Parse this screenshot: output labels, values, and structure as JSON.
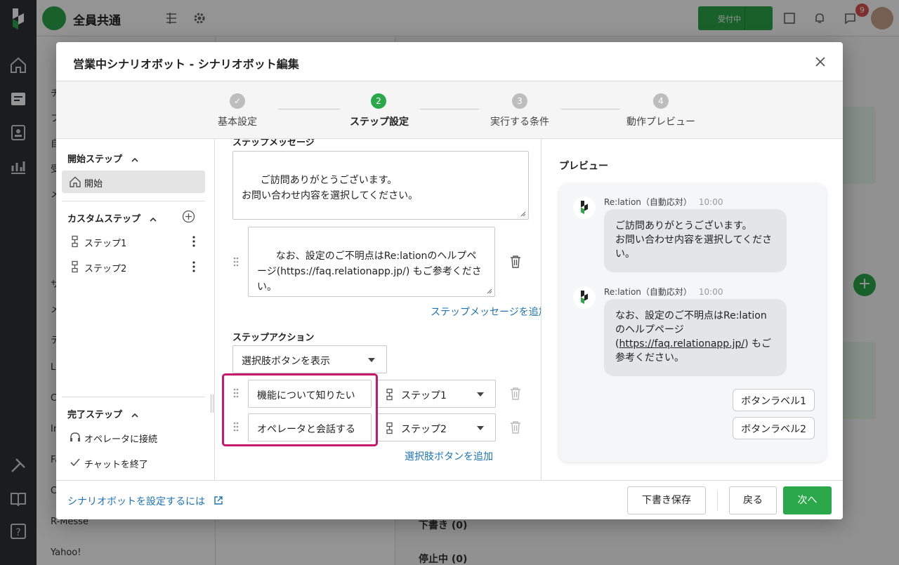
{
  "app": {
    "inbox_title": "全員共通",
    "status_label": "受付中",
    "notifications_count": "9",
    "sidebar_bg": [
      "チ",
      "フ",
      "自",
      "受",
      "メ",
      "サ",
      "メ",
      "テ",
      "L",
      "C",
      "In",
      "Fa",
      "C",
      "R-Messe",
      "Yahoo!"
    ],
    "main_sections": [
      "下書き (0)",
      "停止中 (0)"
    ]
  },
  "modal": {
    "title": "営業中シナリオボット - シナリオボット編集",
    "steps": [
      {
        "num": "✓",
        "label": "基本設定",
        "state": "done"
      },
      {
        "num": "2",
        "label": "ステップ設定",
        "state": "active"
      },
      {
        "num": "3",
        "label": "実行する条件",
        "state": "todo"
      },
      {
        "num": "4",
        "label": "動作プレビュー",
        "state": "todo"
      }
    ]
  },
  "left_panel": {
    "start_header": "開始ステップ",
    "start_item": "開始",
    "custom_header": "カスタムステップ",
    "custom_items": [
      "ステップ1",
      "ステップ2"
    ],
    "end_header": "完了ステップ",
    "end_items": [
      "オペレータに接続",
      "チャットを終了"
    ]
  },
  "center": {
    "message_label": "ステップメッセージ",
    "message1": "ご訪問ありがとうございます。\nお問い合わせ内容を選択してください。",
    "message2": "なお、設定のご不明点はRe:lationのヘルプページ(https://faq.relationapp.jp/) もご参考ください。",
    "add_message_link": "ステップメッセージを追加",
    "action_label": "ステップアクション",
    "action_select": "選択肢ボタンを表示",
    "choices": [
      {
        "text": "機能について知りたい",
        "target": "ステップ1"
      },
      {
        "text": "オペレータと会話する",
        "target": "ステップ2"
      }
    ],
    "add_choice_link": "選択肢ボタンを追加"
  },
  "preview": {
    "heading": "プレビュー",
    "bot_name": "Re:lation（自動応対）",
    "time": "10:00",
    "bubble1": "ご訪問ありがとうございます。\nお問い合わせ内容を選択してください。",
    "bubble2_pre": "なお、設定のご不明点はRe:lationのヘルプページ (",
    "bubble2_link": "https://faq.relationapp.jp/",
    "bubble2_post": ") もご参考ください。",
    "buttons": [
      "ボタンラベル1",
      "ボタンラベル2"
    ]
  },
  "footer": {
    "help_link": "シナリオボットを設定するには",
    "draft_button": "下書き保存",
    "back_button": "戻る",
    "next_button": "次へ"
  },
  "colors": {
    "accent_green": "#2ba84a",
    "link_blue": "#1a73b8",
    "highlight_magenta": "#c8186b"
  }
}
